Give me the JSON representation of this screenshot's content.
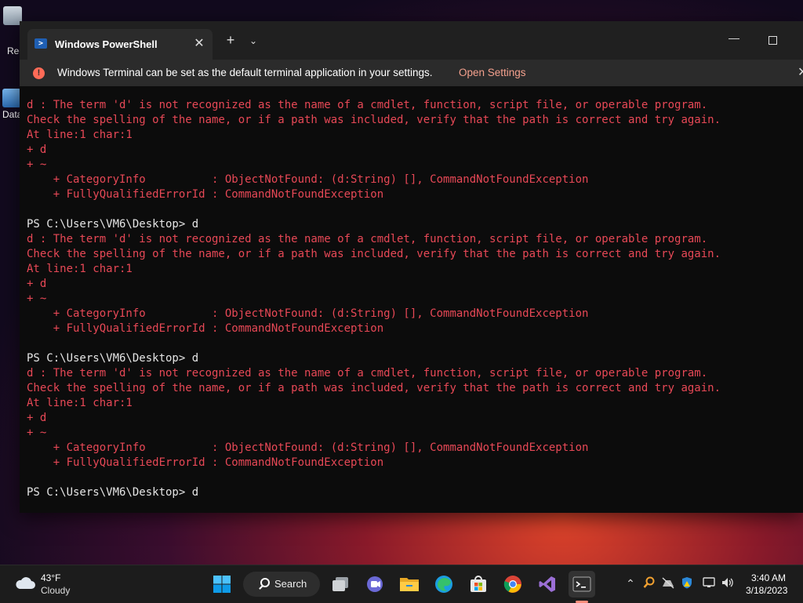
{
  "desktop": {
    "icons": [
      {
        "label": "Rec"
      },
      {
        "label": "Data"
      }
    ]
  },
  "window": {
    "tab_title": "Windows PowerShell",
    "tab_close": "✕",
    "new_tab": "+",
    "dropdown": "⌄",
    "minimize": "—"
  },
  "infobar": {
    "message": "Windows Terminal can be set as the default terminal application in your settings.",
    "link": "Open Settings",
    "close": "✕"
  },
  "console": {
    "lines": [
      {
        "type": "err",
        "text": "d : The term 'd' is not recognized as the name of a cmdlet, function, script file, or operable program."
      },
      {
        "type": "err",
        "text": "Check the spelling of the name, or if a path was included, verify that the path is correct and try again."
      },
      {
        "type": "err",
        "text": "At line:1 char:1"
      },
      {
        "type": "err",
        "text": "+ d"
      },
      {
        "type": "err",
        "text": "+ ~"
      },
      {
        "type": "err",
        "text": "    + CategoryInfo          : ObjectNotFound: (d:String) [], CommandNotFoundException"
      },
      {
        "type": "err",
        "text": "    + FullyQualifiedErrorId : CommandNotFoundException"
      },
      {
        "type": "blank",
        "text": ""
      },
      {
        "type": "prompt",
        "text": "PS C:\\Users\\VM6\\Desktop> d"
      },
      {
        "type": "err",
        "text": "d : The term 'd' is not recognized as the name of a cmdlet, function, script file, or operable program."
      },
      {
        "type": "err",
        "text": "Check the spelling of the name, or if a path was included, verify that the path is correct and try again."
      },
      {
        "type": "err",
        "text": "At line:1 char:1"
      },
      {
        "type": "err",
        "text": "+ d"
      },
      {
        "type": "err",
        "text": "+ ~"
      },
      {
        "type": "err",
        "text": "    + CategoryInfo          : ObjectNotFound: (d:String) [], CommandNotFoundException"
      },
      {
        "type": "err",
        "text": "    + FullyQualifiedErrorId : CommandNotFoundException"
      },
      {
        "type": "blank",
        "text": ""
      },
      {
        "type": "prompt",
        "text": "PS C:\\Users\\VM6\\Desktop> d"
      },
      {
        "type": "err",
        "text": "d : The term 'd' is not recognized as the name of a cmdlet, function, script file, or operable program."
      },
      {
        "type": "err",
        "text": "Check the spelling of the name, or if a path was included, verify that the path is correct and try again."
      },
      {
        "type": "err",
        "text": "At line:1 char:1"
      },
      {
        "type": "err",
        "text": "+ d"
      },
      {
        "type": "err",
        "text": "+ ~"
      },
      {
        "type": "err",
        "text": "    + CategoryInfo          : ObjectNotFound: (d:String) [], CommandNotFoundException"
      },
      {
        "type": "err",
        "text": "    + FullyQualifiedErrorId : CommandNotFoundException"
      },
      {
        "type": "blank",
        "text": ""
      },
      {
        "type": "prompt",
        "text": "PS C:\\Users\\VM6\\Desktop> d"
      }
    ]
  },
  "taskbar": {
    "weather": {
      "temp": "43°F",
      "condition": "Cloudy"
    },
    "search_label": "Search",
    "apps": [
      {
        "name": "start-button",
        "icon": "windows-logo-icon"
      },
      {
        "name": "task-view-button",
        "icon": "task-view-icon"
      },
      {
        "name": "teams-chat-button",
        "icon": "teams-icon"
      },
      {
        "name": "file-explorer-button",
        "icon": "folder-icon"
      },
      {
        "name": "edge-button",
        "icon": "edge-icon"
      },
      {
        "name": "store-button",
        "icon": "store-icon"
      },
      {
        "name": "chrome-button",
        "icon": "chrome-icon"
      },
      {
        "name": "visual-studio-button",
        "icon": "visual-studio-icon"
      },
      {
        "name": "terminal-button",
        "icon": "terminal-icon"
      }
    ],
    "clock": {
      "time": "3:40 AM",
      "date": "3/18/2023"
    }
  },
  "colors": {
    "error_text": "#e74856",
    "console_bg": "#0c0c0c",
    "link": "#f3a08d",
    "accent": "#ff8c7a"
  }
}
